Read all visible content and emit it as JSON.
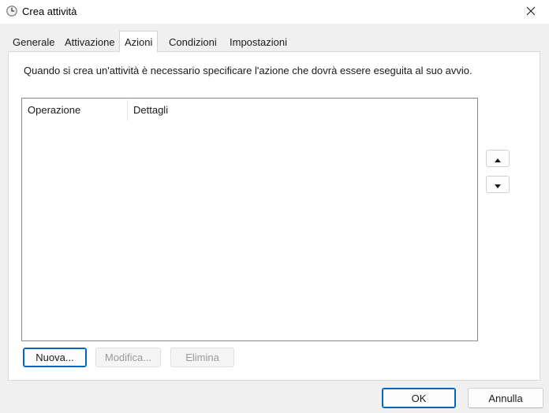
{
  "window": {
    "title": "Crea attività",
    "icon": "task-scheduler-clock-icon",
    "close_icon": "close-icon"
  },
  "tabs": [
    {
      "label": "Generale",
      "selected": false
    },
    {
      "label": "Attivazione",
      "selected": false
    },
    {
      "label": "Azioni",
      "selected": true
    },
    {
      "label": "Condizioni",
      "selected": false
    },
    {
      "label": "Impostazioni",
      "selected": false
    }
  ],
  "actions_panel": {
    "description": "Quando si crea un'attività è necessario specificare l'azione che dovrà essere eseguita al suo avvio.",
    "list": {
      "columns": [
        "Operazione",
        "Dettagli"
      ],
      "rows": []
    },
    "move_up_icon": "triangle-up-icon",
    "move_down_icon": "triangle-down-icon",
    "buttons": {
      "new": "Nuova...",
      "edit": "Modifica...",
      "delete": "Elimina"
    }
  },
  "footer": {
    "ok": "OK",
    "cancel": "Annulla"
  },
  "colors": {
    "accent": "#0067c0",
    "window_bg": "#f0f0f0",
    "panel_bg": "#ffffff"
  }
}
